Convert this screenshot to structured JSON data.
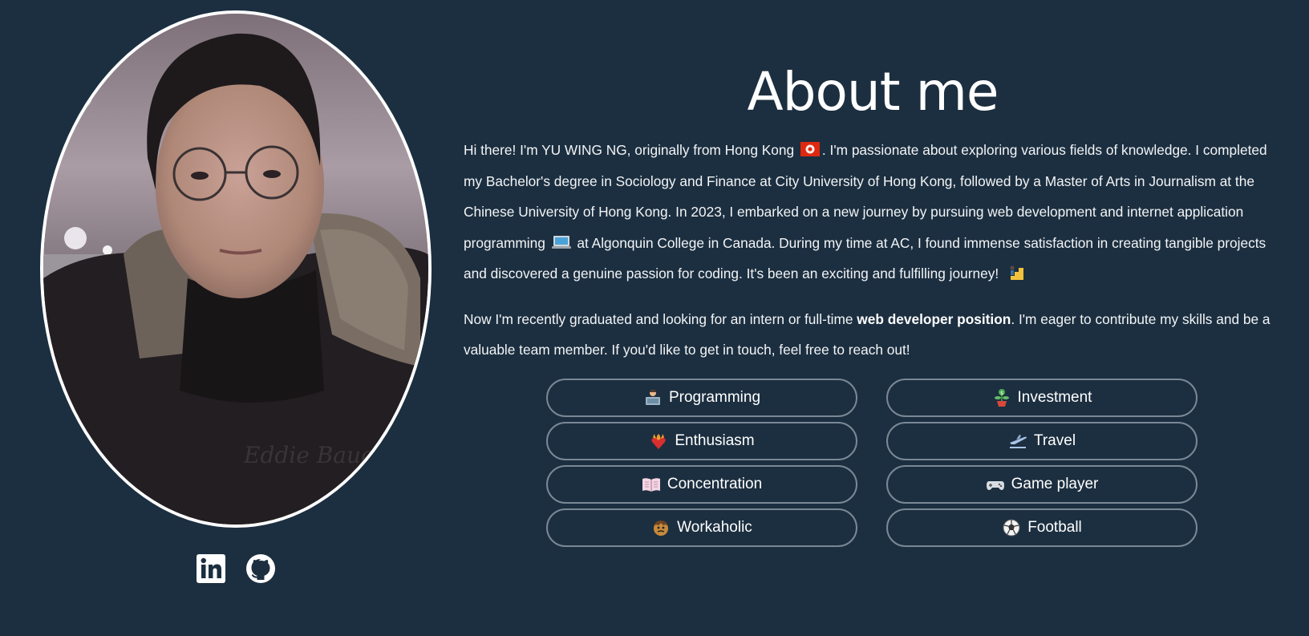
{
  "about": {
    "title": "About me",
    "para1": {
      "p1": "Hi there! I'm YU WING NG, originally from Hong Kong",
      "flag_icon": "hong-kong-flag-icon",
      "p2": ". I'm passionate about exploring various fields of knowledge. I completed my Bachelor's degree in Sociology and Finance at City University of Hong Kong, followed by a Master of Arts in Journalism at the Chinese University of Hong Kong. In 2023, I embarked on a new journey by pursuing web development and internet application programming",
      "laptop_icon": "laptop-icon",
      "p3": " at Algonquin College in Canada. During my time at AC, I found immense satisfaction in creating tangible projects and discovered a genuine passion for coding. It's been an exciting and fulfilling journey!",
      "stairs_icon": "person-climbing-stairs-icon"
    },
    "para2": {
      "p1": "Now I'm recently graduated and looking for an intern or full-time ",
      "bold": "web developer position",
      "p2": ". I'm eager to contribute my skills and be a valuable team member. If you'd like to get in touch, feel free to reach out!"
    }
  },
  "traits": [
    {
      "label": "Programming",
      "icon": "technologist-icon"
    },
    {
      "label": "Investment",
      "icon": "money-plant-icon"
    },
    {
      "label": "Enthusiasm",
      "icon": "heart-on-fire-icon"
    },
    {
      "label": "Travel",
      "icon": "airplane-departure-icon"
    },
    {
      "label": "Concentration",
      "icon": "open-book-icon"
    },
    {
      "label": "Game player",
      "icon": "game-controller-icon"
    },
    {
      "label": "Workaholic",
      "icon": "working-face-icon"
    },
    {
      "label": "Football",
      "icon": "soccer-ball-icon"
    }
  ],
  "social": {
    "linkedin_icon": "linkedin-icon",
    "github_icon": "github-icon"
  },
  "colors": {
    "background": "#1c2f40",
    "border": "#7a8895",
    "text": "#ffffff"
  }
}
